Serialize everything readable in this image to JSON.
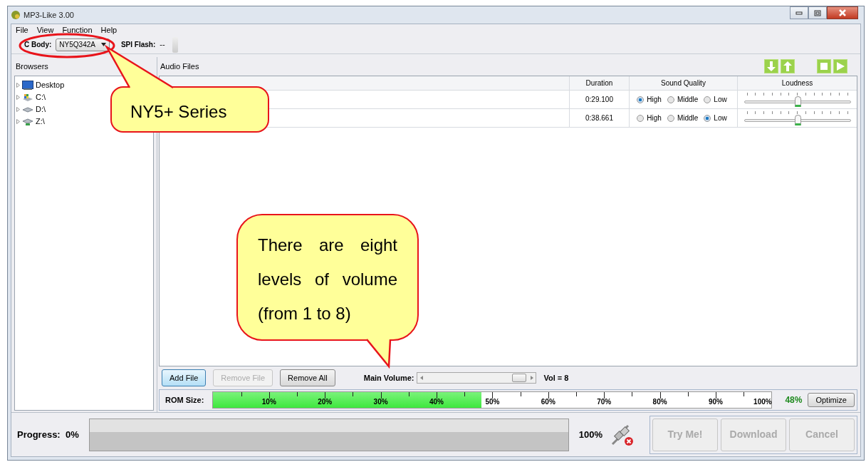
{
  "window": {
    "title": "MP3-Like 3.00"
  },
  "menu": [
    "File",
    "View",
    "Function",
    "Help"
  ],
  "toolbar": {
    "ic_body_label": "C Body:",
    "ic_body_value": "NY5Q342A",
    "spi_flash_label": "SPI Flash:",
    "spi_flash_value": "--"
  },
  "browsers": {
    "title": "Browsers",
    "tree": [
      {
        "label": "Desktop",
        "kind": "desktop"
      },
      {
        "label": "C:\\",
        "kind": "system-drive"
      },
      {
        "label": "D:\\",
        "kind": "drive"
      },
      {
        "label": "Z:\\",
        "kind": "network-drive"
      }
    ]
  },
  "audio_files": {
    "title": "Audio Files",
    "columns": [
      "Duration",
      "Sound Quality",
      "Loudness"
    ],
    "rows": [
      {
        "duration": "0:29.100",
        "quality": [
          {
            "label": "High",
            "selected": true
          },
          {
            "label": "Middle",
            "selected": false
          },
          {
            "label": "Low",
            "selected": false
          }
        ],
        "loudness": {
          "level": 0.5
        }
      },
      {
        "duration": "0:38.661",
        "quality": [
          {
            "label": "High",
            "selected": false
          },
          {
            "label": "Middle",
            "selected": false
          },
          {
            "label": "Low",
            "selected": true
          }
        ],
        "loudness": {
          "level": 0.5
        }
      }
    ]
  },
  "file_buttons": [
    {
      "label": "Add File",
      "disabled": false,
      "selected": true
    },
    {
      "label": "Remove File",
      "disabled": true,
      "selected": false
    },
    {
      "label": "Remove All",
      "disabled": false,
      "selected": false
    }
  ],
  "main_volume": {
    "label": "Main Volume:",
    "level": 1,
    "reading": "Vol = 8"
  },
  "rom": {
    "label": "ROM Size:",
    "level": 0.48,
    "ticks": [
      "10%",
      "20%",
      "30%",
      "40%",
      "50%",
      "60%",
      "70%",
      "80%",
      "90%",
      "100%"
    ],
    "reading": "48%",
    "button": "Optimize"
  },
  "progress": {
    "label": "Progress:  0%",
    "level": 0,
    "end_label": "100%"
  },
  "actions": [
    {
      "label": "Try Me!",
      "disabled": true
    },
    {
      "label": "Download",
      "disabled": true
    },
    {
      "label": "Cancel",
      "disabled": true
    }
  ],
  "annotations": [
    {
      "text": "NY5+ Series"
    },
    {
      "text": "There are eight levels of volume (from 1 to 8)"
    }
  ]
}
